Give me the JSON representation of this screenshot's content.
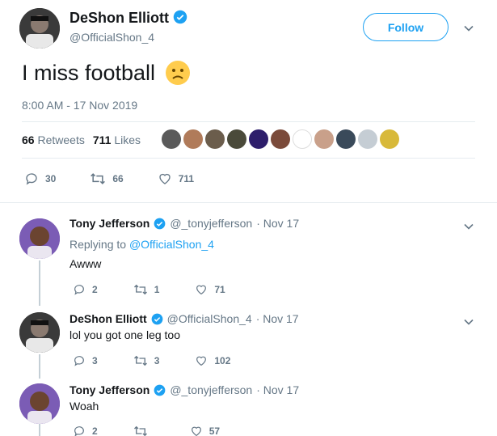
{
  "main": {
    "name": "DeShon Elliott",
    "handle": "@OfficialShon_4",
    "follow_label": "Follow",
    "text": "I miss football",
    "timestamp": "8:00 AM - 17 Nov 2019",
    "retweets_count": "66",
    "retweets_label": "Retweets",
    "likes_count": "711",
    "likes_label": "Likes",
    "actions": {
      "replies": "30",
      "retweets": "66",
      "likes": "711"
    }
  },
  "replies": [
    {
      "name": "Tony Jefferson",
      "handle": "@_tonyjefferson",
      "date": "· Nov 17",
      "replying_prefix": "Replying to",
      "replying_to": "@OfficialShon_4",
      "text": "Awww",
      "replies": "2",
      "retweets": "1",
      "likes": "71"
    },
    {
      "name": "DeShon Elliott",
      "handle": "@OfficialShon_4",
      "date": "· Nov 17",
      "text": "lol you got one leg too",
      "replies": "3",
      "retweets": "3",
      "likes": "102"
    },
    {
      "name": "Tony Jefferson",
      "handle": "@_tonyjefferson",
      "date": "· Nov 17",
      "text": "Woah",
      "replies": "2",
      "retweets": "",
      "likes": "57"
    }
  ],
  "colors": {
    "accent": "#1da1f2",
    "muted": "#657786",
    "text": "#14171a"
  }
}
